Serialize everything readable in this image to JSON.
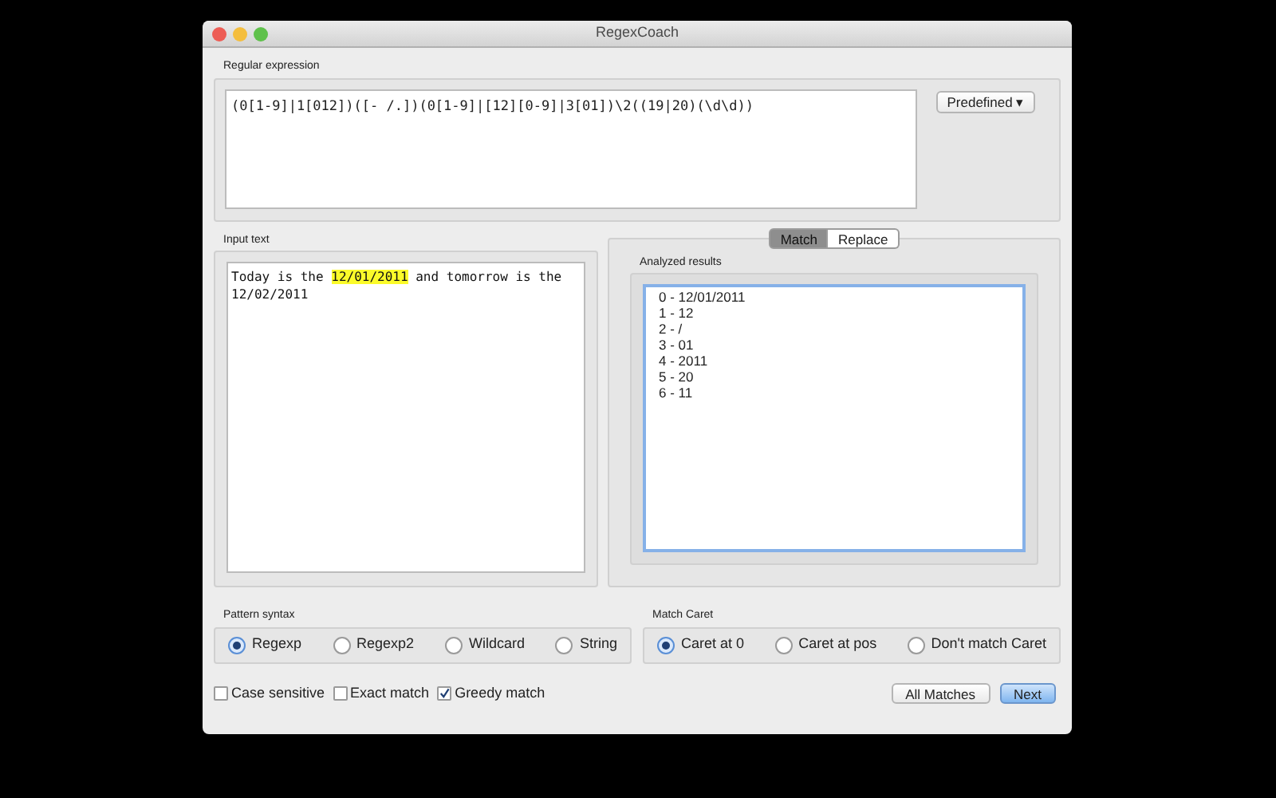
{
  "window": {
    "title": "RegexCoach"
  },
  "regex": {
    "label": "Regular expression",
    "value": "(0[1-9]|1[012])([- /.])(0[1-9]|[12][0-9]|3[01])\\2((19|20)(\\d\\d))",
    "predefined": "Predefined ▾"
  },
  "input": {
    "label": "Input text",
    "lines": [
      [
        {
          "text": "Today is the ",
          "highlighted": false
        },
        {
          "text": "12/01/2011",
          "highlighted": true
        },
        {
          "text": " and tomorrow is the",
          "highlighted": false
        }
      ],
      [
        {
          "text": "12/02/2011",
          "highlighted": false
        }
      ]
    ]
  },
  "tabs": [
    {
      "label": "Match",
      "selected": true
    },
    {
      "label": "Replace",
      "selected": false
    }
  ],
  "results": {
    "label": "Analyzed results",
    "items": [
      "0 - 12/01/2011",
      "1 - 12",
      "2 - /",
      "3 - 01",
      "4 - 2011",
      "5 - 20",
      "6 - 11"
    ]
  },
  "pattern_syntax": {
    "label": "Pattern syntax",
    "options": [
      {
        "label": "Regexp",
        "selected": true
      },
      {
        "label": "Regexp2",
        "selected": false
      },
      {
        "label": "Wildcard",
        "selected": false
      },
      {
        "label": "String",
        "selected": false
      }
    ]
  },
  "match_caret": {
    "label": "Match Caret",
    "options": [
      {
        "label": "Caret at 0",
        "selected": true
      },
      {
        "label": "Caret at pos",
        "selected": false
      },
      {
        "label": "Don't match Caret",
        "selected": false
      }
    ]
  },
  "checkboxes": [
    {
      "label": "Case sensitive",
      "checked": false
    },
    {
      "label": "Exact match",
      "checked": false
    },
    {
      "label": "Greedy match",
      "checked": true
    }
  ],
  "buttons": [
    {
      "label": "All Matches",
      "kind": "normal"
    },
    {
      "label": "Next",
      "kind": "default"
    }
  ]
}
